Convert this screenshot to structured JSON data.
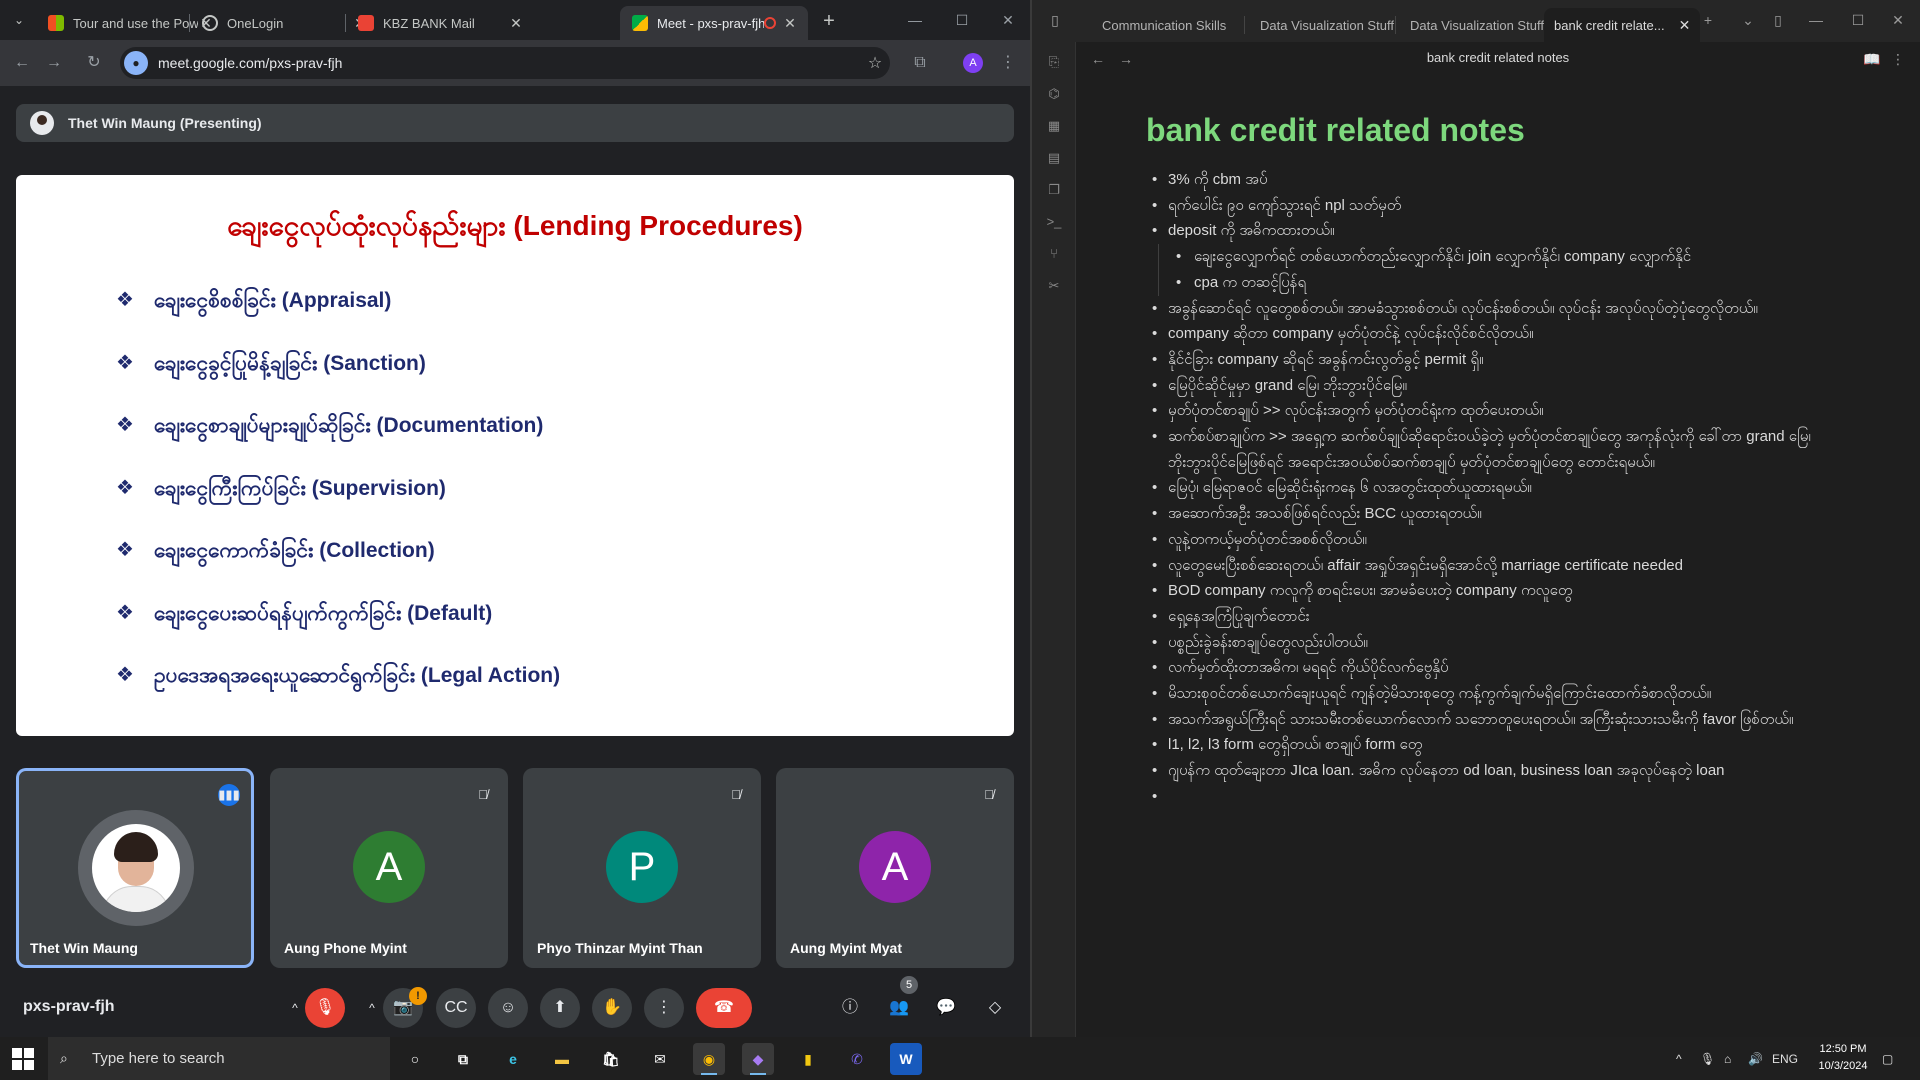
{
  "chrome": {
    "tabs": [
      {
        "title": "Tour and use the Power",
        "icon": "microsoft-icon",
        "active": false
      },
      {
        "title": "OneLogin",
        "icon": "onelogin-icon",
        "active": false
      },
      {
        "title": "KBZ BANK Mail",
        "icon": "gmail-icon",
        "active": false
      },
      {
        "title": "Meet - pxs-prav-fjh",
        "icon": "meet-icon",
        "active": true
      }
    ],
    "url": "meet.google.com/pxs-prav-fjh",
    "profile_initial": "A"
  },
  "meet": {
    "presenter_label": "Thet Win Maung (Presenting)",
    "slide": {
      "title": "ချေးငွေလုပ်ထုံးလုပ်နည်းများ (Lending Procedures)",
      "items": [
        "ချေးငွေစိစစ်ခြင်း (Appraisal)",
        "ချေးငွေခွင့်ပြုမိန့်ချခြင်း (Sanction)",
        "ချေးငွေစာချုပ်များချုပ်ဆိုခြင်း (Documentation)",
        "ချေးငွေကြီးကြပ်ခြင်း (Supervision)",
        "ချေးငွေကောက်ခံခြင်း (Collection)",
        "ချေးငွေပေးဆပ်ရန်ပျက်ကွက်ခြင်း (Default)",
        "ဥပဒေအရအရေးယူဆောင်ရွက်ခြင်း (Legal Action)"
      ]
    },
    "participants": [
      {
        "name": "Thet Win Maung",
        "initial": "",
        "color": "",
        "speaking": true
      },
      {
        "name": "Aung Phone Myint",
        "initial": "A",
        "color": "#2e7d32",
        "speaking": false
      },
      {
        "name": "Phyo Thinzar Myint Than",
        "initial": "P",
        "color": "#00897b",
        "speaking": false
      },
      {
        "name": "Aung Myint Myat",
        "initial": "A",
        "color": "#8e24aa",
        "speaking": false
      }
    ],
    "meeting_code": "pxs-prav-fjh",
    "camera_alert": "!",
    "people_count": "5"
  },
  "obsidian": {
    "tabs": [
      "Communication Skills",
      "Data Visualization Stuff",
      "Data Visualization Stuff",
      "bank credit relate..."
    ],
    "nav_title": "bank credit related notes",
    "note_title": "bank credit related notes",
    "lines": [
      {
        "text": "3% ကို cbm အပ်",
        "level": 1
      },
      {
        "text": "ရက်ပေါင်း ၉၀ ကျော်သွားရင် npl သတ်မှတ်",
        "level": 1
      },
      {
        "text": "deposit ကို အဓိကထားတယ်။",
        "level": 1
      },
      {
        "text": "ချေးငွေလျှောက်ရင် တစ်ယောက်တည်းလျှောက်နိုင်၊ join လျှောက်နိုင်၊ company လျှောက်နိုင်",
        "level": 2
      },
      {
        "text": "cpa က တဆင့်ပြန်ရ",
        "level": 2
      },
      {
        "text": "အခွန်ဆောင်ရင် လူတွေစစ်တယ်။ အာမခံသွားစစ်တယ်၊ လုပ်ငန်းစစ်တယ်။ လုပ်ငန်း အလုပ်လုပ်တဲ့ပုံတွေလိုတယ်။",
        "level": 1
      },
      {
        "text": "company ဆိုတာ company မှတ်ပုံတင်နဲ့ လုပ်ငန်းလိုင်စင်လိုတယ်။",
        "level": 1
      },
      {
        "text": "နိုင်ငံခြား company ဆိုရင် အခွန်ကင်းလွတ်ခွင့် permit ရှိ။",
        "level": 1
      },
      {
        "text": "မြေပိုင်ဆိုင်မှုမှာ grand မြေ၊ ဘိုးဘွားပိုင်မြေ။",
        "level": 1
      },
      {
        "text": "မှတ်ပုံတင်စာချုပ် >> လုပ်ငန်းအတွက် မှတ်ပုံတင်ရုံးက ထုတ်ပေးတယ်။",
        "level": 1
      },
      {
        "text": "ဆက်စပ်စာချုပ်က >> အရှေ့က ဆက်စပ်ချုပ်ဆိုရောင်းဝယ်ခဲ့တဲ့ မှတ်ပုံတင်စာချုပ်တွေ အကုန်လုံးကို ခေါ်တာ grand မြေ၊ ဘိုးဘွားပိုင်မြေဖြစ်ရင် အရောင်းအဝယ်စပ်ဆက်စာချုပ် မှတ်ပုံတင်စာချုပ်တွေ တောင်းရမယ်။",
        "level": 1
      },
      {
        "text": "မြေပုံ၊ မြေရာဇဝင် မြေဆိုင်းရုံးကနေ ၆ လအတွင်းထုတ်ယူထားရမယ်။",
        "level": 1
      },
      {
        "text": "အဆောက်အဦး အသစ်ဖြစ်ရင်လည်း BCC ယူထားရတယ်။",
        "level": 1
      },
      {
        "text": "လူနဲ့တကယ့်မှတ်ပုံတင်အစစ်လိုတယ်။",
        "level": 1
      },
      {
        "text": "လူတွေမေးပြီးစစ်ဆေးရတယ်၊ affair အရှုပ်အရှင်းမရှိအောင်လို့ marriage certificate needed",
        "level": 1
      },
      {
        "text": "BOD company ကလူကို စာရင်းပေး၊ အာမခံပေးတဲ့ company ကလူတွေ",
        "level": 1
      },
      {
        "text": "ရှေ့နေအကြံပြုချက်တောင်း",
        "level": 1
      },
      {
        "text": "ပစ္စည်းခွဲခန်းစာချုပ်တွေလည်းပါတယ်။",
        "level": 1
      },
      {
        "text": "လက်မှတ်ထိုးတာအဓိက၊ မရရင် ကိုယ်ပိုင်လက်ဗွေနှိပ်",
        "level": 1
      },
      {
        "text": "မိသားစုဝင်တစ်ယောက်ချေးယူရင် ကျန်တဲ့မိသားစုတွေ ကန့်ကွက်ချက်မရှိကြောင်းထောက်ခံစာလိုတယ်။",
        "level": 1
      },
      {
        "text": "အသက်အရွယ်ကြီးရင် သားသမီးတစ်ယောက်လောက် သဘောတူပေးရတယ်။ အကြီးဆုံးသားသမီးကို favor ဖြစ်တယ်။",
        "level": 1
      },
      {
        "text": "l1, l2, l3 form တွေရှိတယ်၊ စာချုပ် form တွေ",
        "level": 1
      },
      {
        "text": "ဂျပန်က ထုတ်ချေးတာ JIca loan. အဓိက လုပ်နေတာ od loan, business loan အခုလုပ်နေတဲ့ loan",
        "level": 1
      },
      {
        "text": "",
        "level": 1
      }
    ]
  },
  "taskbar": {
    "search_placeholder": "Type here to search",
    "lang": "ENG",
    "time": "12:50 PM",
    "date": "10/3/2024"
  }
}
